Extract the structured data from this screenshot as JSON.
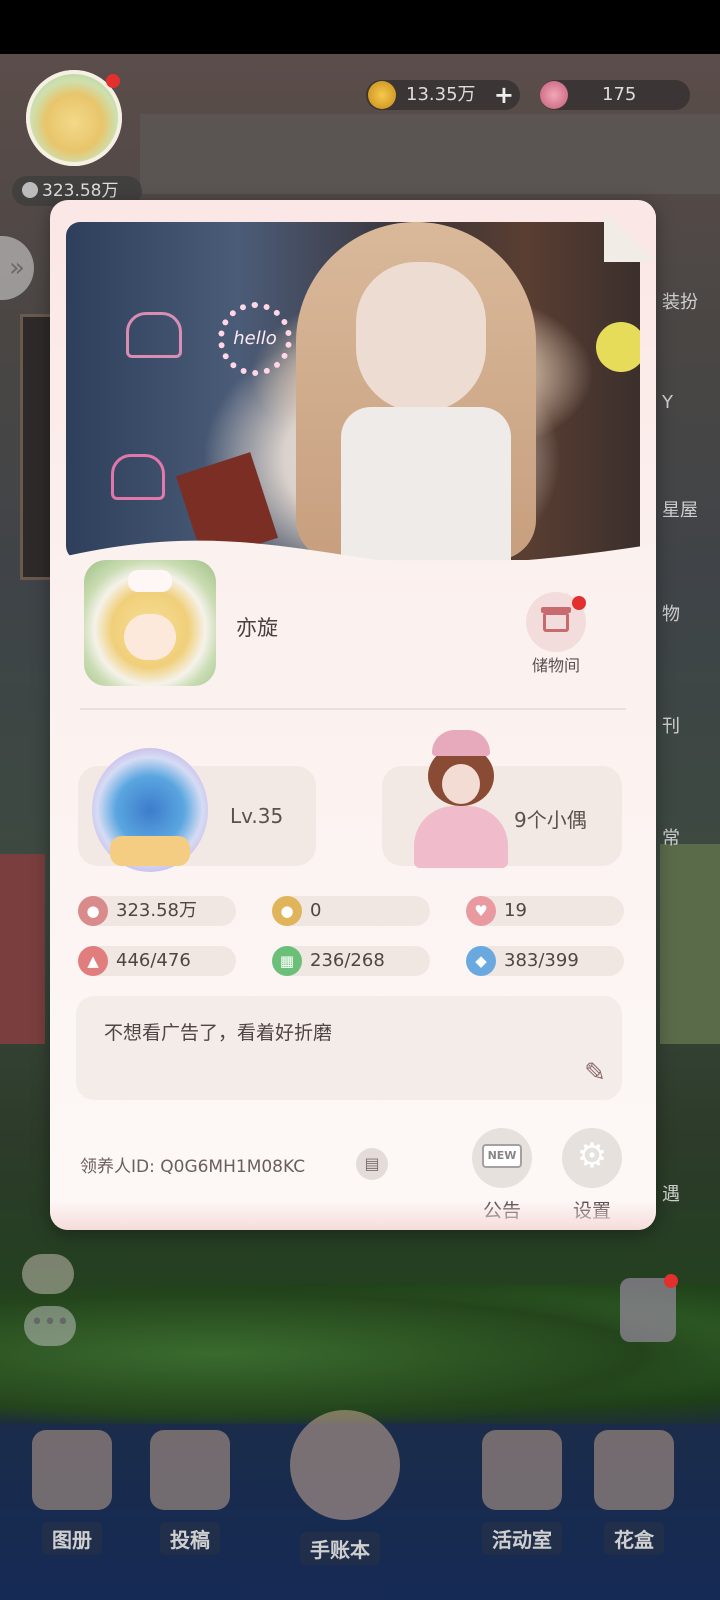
{
  "hud": {
    "fans_count": "323.58万",
    "coins": "13.35万",
    "coins_add": "+",
    "gems": "175"
  },
  "right_side_labels": [
    "装扮",
    "Y",
    "星屋",
    "物",
    "刊",
    "常",
    "遇"
  ],
  "profile": {
    "nickname": "亦旋",
    "storage_label": "储物间",
    "level": "Lv.35",
    "dolls": "9个小偶",
    "stats": [
      {
        "icon": "fans-icon",
        "value": "323.58万",
        "color": "#d98b8b"
      },
      {
        "icon": "footprint-icon",
        "value": "0",
        "color": "#e0b45a"
      },
      {
        "icon": "heart-card-icon",
        "value": "19",
        "color": "#e99aa0"
      },
      {
        "icon": "dress-icon",
        "value": "446/476",
        "color": "#e27d7d"
      },
      {
        "icon": "furniture-icon",
        "value": "236/268",
        "color": "#6cbf78"
      },
      {
        "icon": "bag-icon",
        "value": "383/399",
        "color": "#6aa8e0"
      }
    ],
    "motto": "不想看广告了，看着好折磨",
    "adopter_id_label": "领养人ID:",
    "adopter_id": "Q0G6MH1M08KC",
    "notice_tag": "NEW",
    "notice_label": "公告",
    "settings_label": "设置",
    "photo_neon_text": "hello"
  },
  "bottom_nav": [
    {
      "label": "图册"
    },
    {
      "label": "投稿"
    },
    {
      "label": "手账本"
    },
    {
      "label": "活动室"
    },
    {
      "label": "花盒"
    }
  ],
  "colors": {
    "card_bg": "#fbf1ef",
    "badge_red": "#e2302e",
    "text_main": "#4e4545"
  }
}
